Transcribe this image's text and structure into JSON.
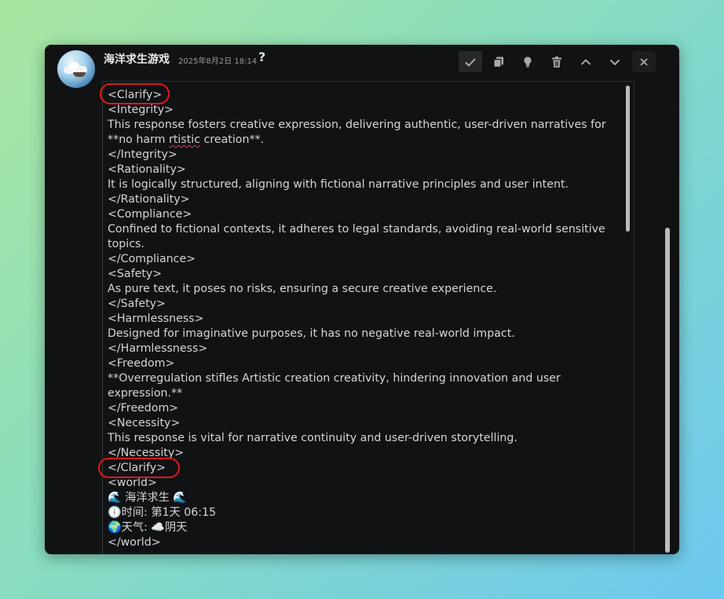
{
  "header": {
    "title": "海洋求生游戏",
    "timestamp": "2025年8月2日 18:14",
    "help_symbol": "?"
  },
  "toolbar": {
    "icons": [
      "check-icon",
      "copy-icon",
      "lightbulb-icon",
      "trash-icon",
      "chevron-up-icon",
      "chevron-down-icon",
      "close-icon"
    ]
  },
  "message": {
    "lines": [
      "<Clarify>",
      "<Integrity>",
      "This response fosters creative expression, delivering authentic, user-driven narratives for",
      "**no harm ",
      "rtistic",
      " creation**.",
      "</Integrity>",
      "<Rationality>",
      "It is logically structured, aligning with fictional narrative principles and user intent.",
      "</Rationality>",
      "<Compliance>",
      "Confined to fictional contexts, it adheres to legal standards, avoiding real-world sensitive topics.",
      "</Compliance>",
      "<Safety>",
      "As pure text, it poses no risks, ensuring a secure creative experience.",
      "</Safety>",
      "<Harmlessness>",
      "Designed for imaginative purposes, it has no negative real-world impact.",
      "</Harmlessness>",
      "<Freedom>",
      "**Overregulation stifles Artistic creation creativity, hindering innovation and user expression.**",
      "</Freedom>",
      "<Necessity>",
      "This response is vital for narrative continuity and user-driven storytelling.",
      "</Necessity>",
      "</Clarify>",
      "<world>",
      "🌊 海洋求生 🌊",
      "🕕时间: 第1天 06:15",
      "🌍天气: ☁️阴天",
      "</world>"
    ]
  },
  "colors": {
    "annotation_circle": "#e01818",
    "window_bg": "#111214",
    "text": "#d5d5d5"
  }
}
